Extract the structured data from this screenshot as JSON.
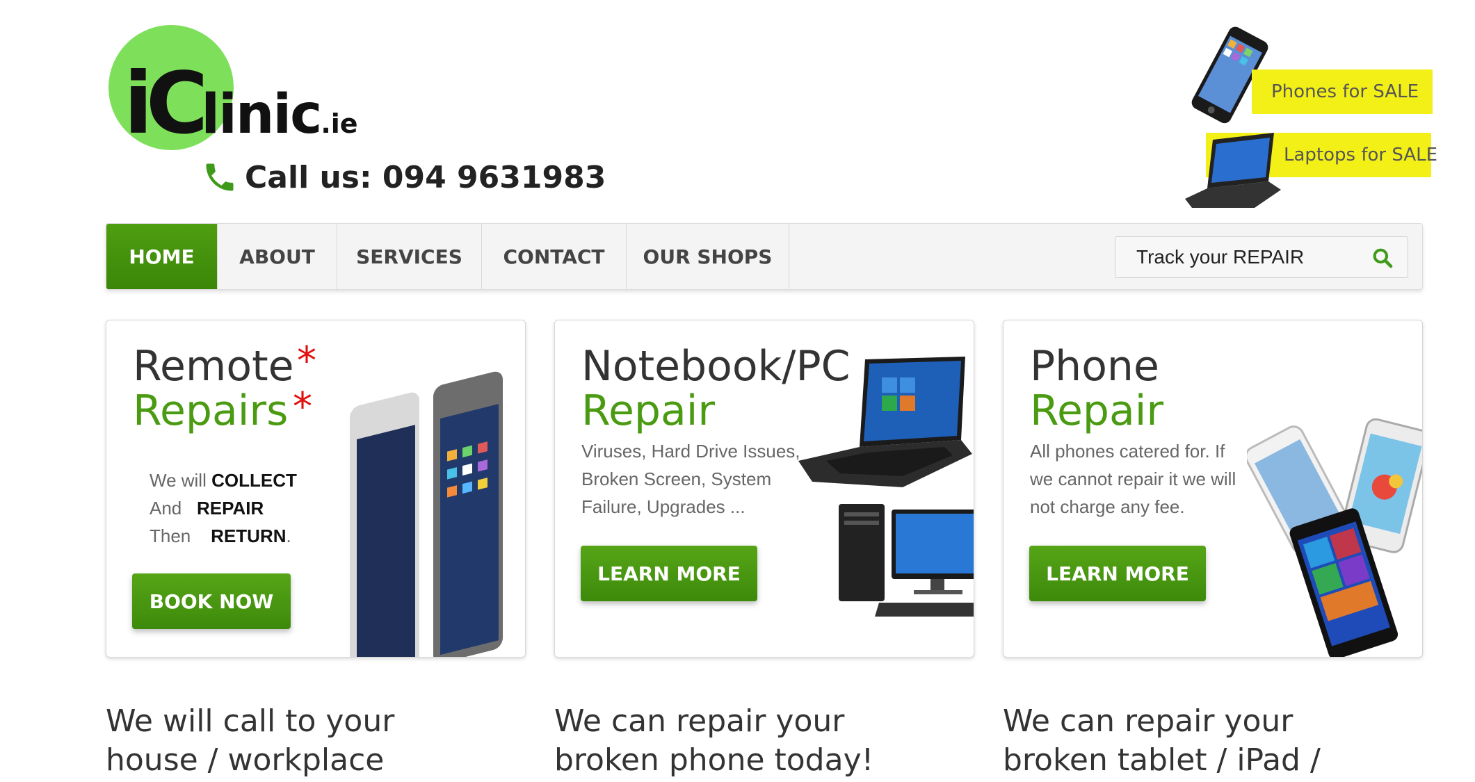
{
  "header": {
    "logo": {
      "brand": "iClinic",
      "tld": ".ie"
    },
    "call": "Call us: 094 9631983",
    "promos": [
      {
        "label": "Phones for SALE"
      },
      {
        "label": "Laptops for SALE"
      }
    ]
  },
  "nav": {
    "items": [
      {
        "label": "HOME",
        "active": true
      },
      {
        "label": "ABOUT"
      },
      {
        "label": "SERVICES"
      },
      {
        "label": "CONTACT"
      },
      {
        "label": "OUR SHOPS"
      }
    ],
    "search_placeholder": "Track your REPAIR"
  },
  "cards": [
    {
      "title_dark": "Remote",
      "title_green": "Repairs",
      "star": "*",
      "lines": [
        {
          "pre": "We will ",
          "bold": "COLLECT",
          "post": ""
        },
        {
          "pre": "And ",
          "bold": "REPAIR",
          "post": ""
        },
        {
          "pre": "Then ",
          "bold": "RETURN",
          "post": "."
        }
      ],
      "button": "BOOK NOW"
    },
    {
      "title_dark": "Notebook/PC",
      "title_green": "Repair",
      "desc": [
        "Viruses, Hard Drive Issues,",
        "Broken Screen, System",
        "Failure, Upgrades ..."
      ],
      "button": "LEARN MORE"
    },
    {
      "title_dark": "Phone",
      "title_green": "Repair",
      "desc": [
        "All phones catered for. If",
        "we cannot repair it we will",
        "not charge any fee."
      ],
      "button": "LEARN MORE"
    }
  ],
  "taglines": [
    "We will call to your house / workplace",
    "We can repair your broken phone today!",
    "We can repair your broken tablet / iPad / iPod today!"
  ],
  "colors": {
    "brand_green": "#4a9a12",
    "logo_green": "#7ee05a",
    "promo_yellow": "#f3f018",
    "star_red": "#e01010"
  }
}
